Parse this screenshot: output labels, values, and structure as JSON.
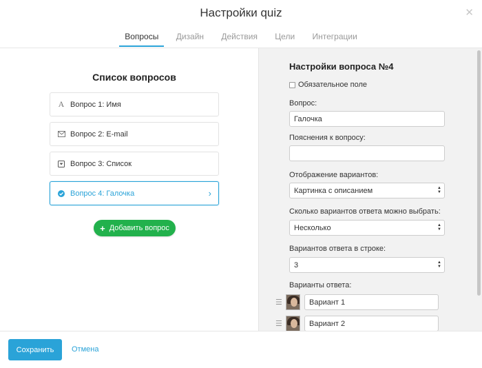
{
  "dialog": {
    "title": "Настройки quiz"
  },
  "tabs": [
    {
      "label": "Вопросы",
      "active": true
    },
    {
      "label": "Дизайн",
      "active": false
    },
    {
      "label": "Действия",
      "active": false
    },
    {
      "label": "Цели",
      "active": false
    },
    {
      "label": "Интеграции",
      "active": false
    }
  ],
  "questions": {
    "title": "Список вопросов",
    "items": [
      {
        "label": "Вопрос 1: Имя",
        "icon": "text-icon"
      },
      {
        "label": "Вопрос 2: E-mail",
        "icon": "envelope-icon"
      },
      {
        "label": "Вопрос 3: Список",
        "icon": "dropdown-icon"
      },
      {
        "label": "Вопрос 4: Галочка",
        "icon": "check-circle-icon",
        "active": true
      }
    ],
    "add_label": "Добавить вопрос"
  },
  "settings": {
    "title": "Настройки вопроса №4",
    "required_label": "Обязательное поле",
    "required_checked": false,
    "question_label": "Вопрос:",
    "question_value": "Галочка",
    "hint_label": "Пояснения к вопросу:",
    "hint_value": "",
    "display_label": "Отображение вариантов:",
    "display_value": "Картинка с описанием",
    "choice_count_label": "Сколько вариантов ответа можно выбрать:",
    "choice_count_value": "Несколько",
    "per_row_label": "Вариантов ответа в строке:",
    "per_row_value": "3",
    "options_label": "Варианты ответа:",
    "options": [
      {
        "value": "Вариант 1"
      },
      {
        "value": "Вариант 2"
      }
    ]
  },
  "footer": {
    "save_label": "Сохранить",
    "cancel_label": "Отмена"
  },
  "colors": {
    "accent": "#2aa3d8",
    "add_button": "#22b14c",
    "panel_bg": "#f2f2f2"
  }
}
